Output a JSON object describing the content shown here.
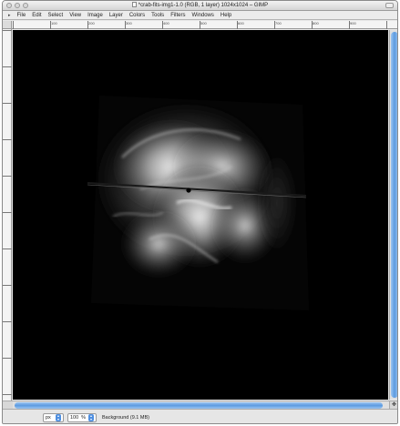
{
  "window": {
    "title": "*crab-fits-img1-1.0 (RGB, 1 layer) 1024x1024 – GIMP"
  },
  "menu": [
    {
      "label": "File"
    },
    {
      "label": "Edit"
    },
    {
      "label": "Select"
    },
    {
      "label": "View"
    },
    {
      "label": "Image"
    },
    {
      "label": "Layer"
    },
    {
      "label": "Colors"
    },
    {
      "label": "Tools"
    },
    {
      "label": "Filters"
    },
    {
      "label": "Windows"
    },
    {
      "label": "Help"
    }
  ],
  "ruler": {
    "labels": [
      "100",
      "200",
      "300",
      "400",
      "500",
      "600",
      "700",
      "800",
      "900"
    ]
  },
  "statusbar": {
    "unit": "px",
    "zoom": "100",
    "zoom_unit": "%",
    "status": "Background (9.1 MB)"
  },
  "colors": {
    "canvas_bg": "#000000",
    "scroll_accent": "#5c9ae0"
  }
}
